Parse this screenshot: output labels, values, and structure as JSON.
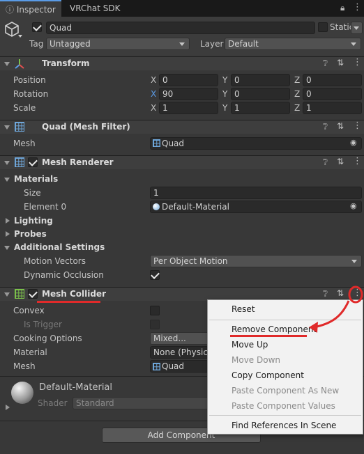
{
  "tabs": {
    "inspector": "Inspector",
    "vrchat": "VRChat SDK"
  },
  "object": {
    "name": "Quad",
    "static_label": "Static",
    "tag_label": "Tag",
    "tag_value": "Untagged",
    "layer_label": "Layer",
    "layer_value": "Default"
  },
  "transform": {
    "title": "Transform",
    "position_label": "Position",
    "rotation_label": "Rotation",
    "scale_label": "Scale",
    "axes": {
      "x": "X",
      "y": "Y",
      "z": "Z"
    },
    "position": {
      "x": "0",
      "y": "0",
      "z": "0"
    },
    "rotation": {
      "x": "90",
      "y": "0",
      "z": "0"
    },
    "scale": {
      "x": "1",
      "y": "1",
      "z": "1"
    }
  },
  "mesh_filter": {
    "title": "Quad (Mesh Filter)",
    "mesh_label": "Mesh",
    "mesh_value": "Quad"
  },
  "mesh_renderer": {
    "title": "Mesh Renderer",
    "materials_label": "Materials",
    "size_label": "Size",
    "size_value": "1",
    "element0_label": "Element 0",
    "element0_value": "Default-Material",
    "lighting_label": "Lighting",
    "probes_label": "Probes",
    "additional_label": "Additional Settings",
    "motion_vectors_label": "Motion Vectors",
    "motion_vectors_value": "Per Object Motion",
    "dynamic_occlusion_label": "Dynamic Occlusion"
  },
  "mesh_collider": {
    "title": "Mesh Collider",
    "convex_label": "Convex",
    "is_trigger_label": "Is Trigger",
    "cooking_label": "Cooking Options",
    "cooking_value": "Mixed...",
    "material_label": "Material",
    "material_value": "None (Physic",
    "mesh_label": "Mesh",
    "mesh_value": "Quad"
  },
  "material_preview": {
    "name": "Default-Material",
    "shader_label": "Shader",
    "shader_value": "Standard"
  },
  "add_component": "Add Component",
  "context_menu": {
    "reset": "Reset",
    "remove": "Remove Component",
    "move_up": "Move Up",
    "move_down": "Move Down",
    "copy": "Copy Component",
    "paste_new": "Paste Component As New",
    "paste_values": "Paste Component Values",
    "find_refs": "Find References In Scene"
  },
  "colors": {
    "annotation": "#e02a2a",
    "accent": "#5a9be6"
  }
}
